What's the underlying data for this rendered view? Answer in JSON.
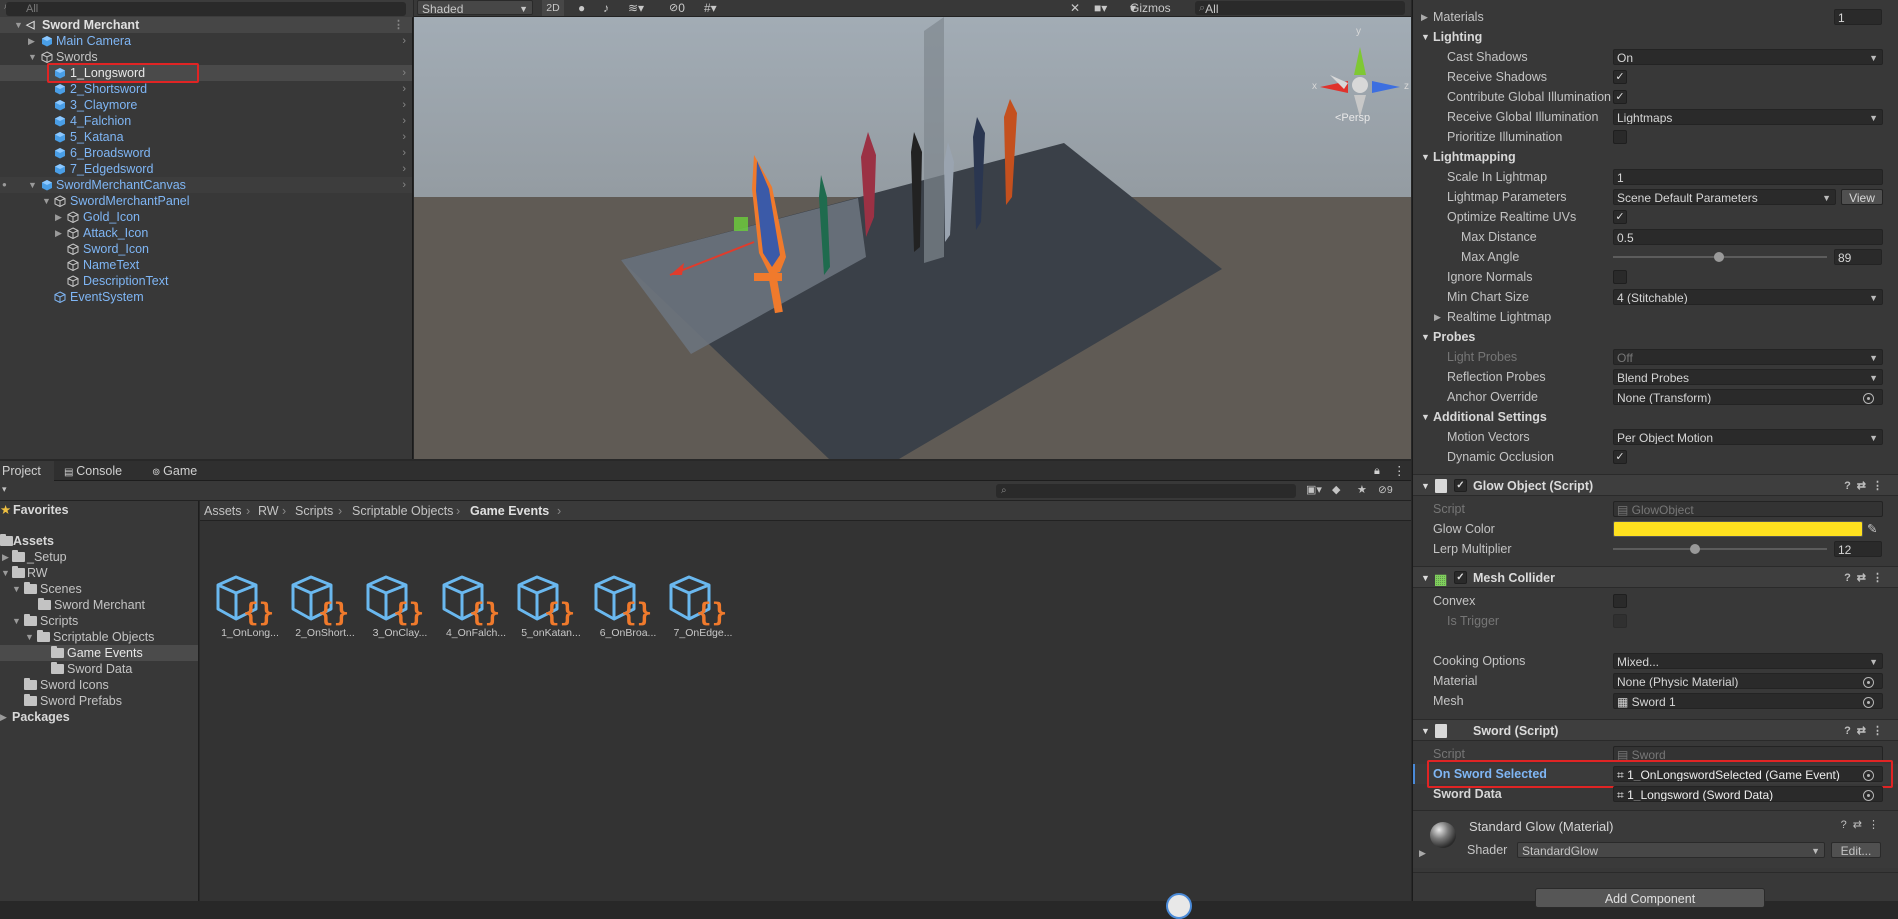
{
  "hierarchy": {
    "search_placeholder": "All",
    "items": [
      {
        "label": "Sword Merchant"
      },
      {
        "label": "Main Camera"
      },
      {
        "label": "Swords"
      },
      {
        "label": "1_Longsword"
      },
      {
        "label": "2_Shortsword"
      },
      {
        "label": "3_Claymore"
      },
      {
        "label": "4_Falchion"
      },
      {
        "label": "5_Katana"
      },
      {
        "label": "6_Broadsword"
      },
      {
        "label": "7_Edgedsword"
      },
      {
        "label": "SwordMerchantCanvas"
      },
      {
        "label": "SwordMerchantPanel"
      },
      {
        "label": "Gold_Icon"
      },
      {
        "label": "Attack_Icon"
      },
      {
        "label": "Sword_Icon"
      },
      {
        "label": "NameText"
      },
      {
        "label": "DescriptionText"
      },
      {
        "label": "EventSystem"
      }
    ]
  },
  "scene": {
    "shading_mode": "Shaded",
    "mode_2d": "2D",
    "hidden_count": "0",
    "gizmos_label": "Gizmos",
    "search_placeholder": "All",
    "persp_label": "<Persp",
    "axis_y": "y",
    "axis_x": "x",
    "axis_z": "z"
  },
  "project": {
    "tabs": [
      {
        "label": "Project"
      },
      {
        "label": "Console"
      },
      {
        "label": "Game"
      }
    ],
    "visible_count": "9",
    "tree": [
      {
        "label": "Favorites"
      },
      {
        "label": "Assets"
      },
      {
        "label": "_Setup"
      },
      {
        "label": "RW"
      },
      {
        "label": "Scenes"
      },
      {
        "label": "Sword Merchant"
      },
      {
        "label": "Scripts"
      },
      {
        "label": "Scriptable Objects"
      },
      {
        "label": "Game Events"
      },
      {
        "label": "Sword Data"
      },
      {
        "label": "Sword Icons"
      },
      {
        "label": "Sword Prefabs"
      },
      {
        "label": "Packages"
      }
    ],
    "breadcrumb": [
      "Assets",
      "RW",
      "Scripts",
      "Scriptable Objects",
      "Game Events"
    ],
    "assets": [
      {
        "label": "1_OnLong..."
      },
      {
        "label": "2_OnShort..."
      },
      {
        "label": "3_OnClay..."
      },
      {
        "label": "4_OnFalch..."
      },
      {
        "label": "5_onKatan..."
      },
      {
        "label": "6_OnBroa..."
      },
      {
        "label": "7_OnEdge..."
      }
    ]
  },
  "inspector": {
    "materials": {
      "label": "Materials",
      "value": "1"
    },
    "lighting": {
      "title": "Lighting",
      "cast_shadows": {
        "label": "Cast Shadows",
        "value": "On"
      },
      "receive_shadows": {
        "label": "Receive Shadows"
      },
      "contribute_gi": {
        "label": "Contribute Global Illumination"
      },
      "receive_gi": {
        "label": "Receive Global Illumination",
        "value": "Lightmaps"
      },
      "prioritize": {
        "label": "Prioritize Illumination"
      }
    },
    "lightmapping": {
      "title": "Lightmapping",
      "scale": {
        "label": "Scale In Lightmap",
        "value": "1"
      },
      "params": {
        "label": "Lightmap Parameters",
        "value": "Scene Default Parameters",
        "button": "View"
      },
      "optimize": {
        "label": "Optimize Realtime UVs"
      },
      "max_distance": {
        "label": "Max Distance",
        "value": "0.5"
      },
      "max_angle": {
        "label": "Max Angle",
        "value": "89"
      },
      "ignore_normals": {
        "label": "Ignore Normals"
      },
      "min_chart": {
        "label": "Min Chart Size",
        "value": "4 (Stitchable)"
      },
      "realtime": {
        "label": "Realtime Lightmap"
      }
    },
    "probes": {
      "title": "Probes",
      "light_probes": {
        "label": "Light Probes",
        "value": "Off"
      },
      "reflection": {
        "label": "Reflection Probes",
        "value": "Blend Probes"
      },
      "anchor": {
        "label": "Anchor Override",
        "value": "None (Transform)"
      }
    },
    "additional": {
      "title": "Additional Settings",
      "motion": {
        "label": "Motion Vectors",
        "value": "Per Object Motion"
      },
      "occlusion": {
        "label": "Dynamic Occlusion"
      }
    },
    "glow": {
      "title": "Glow Object (Script)",
      "script": {
        "label": "Script",
        "value": "GlowObject"
      },
      "color": {
        "label": "Glow Color",
        "hex": "#ffe11f"
      },
      "lerp": {
        "label": "Lerp Multiplier",
        "value": "12"
      }
    },
    "mesh_collider": {
      "title": "Mesh Collider",
      "convex": {
        "label": "Convex"
      },
      "trigger": {
        "label": "Is Trigger"
      },
      "cooking": {
        "label": "Cooking Options",
        "value": "Mixed..."
      },
      "material": {
        "label": "Material",
        "value": "None (Physic Material)"
      },
      "mesh": {
        "label": "Mesh",
        "value": "Sword 1"
      }
    },
    "sword": {
      "title": "Sword (Script)",
      "script": {
        "label": "Script",
        "value": "Sword"
      },
      "selected": {
        "label": "On Sword Selected",
        "value": "1_OnLongswordSelected (Game Event)"
      },
      "data": {
        "label": "Sword Data",
        "value": "1_Longsword (Sword Data)"
      }
    },
    "material_block": {
      "title": "Standard Glow (Material)",
      "shader_label": "Shader",
      "shader_value": "StandardGlow",
      "edit": "Edit..."
    },
    "add_component": "Add Component"
  },
  "colors": {
    "highlight": "#e02424",
    "link": "#7fb6f5",
    "accent": "#f07a2c"
  }
}
